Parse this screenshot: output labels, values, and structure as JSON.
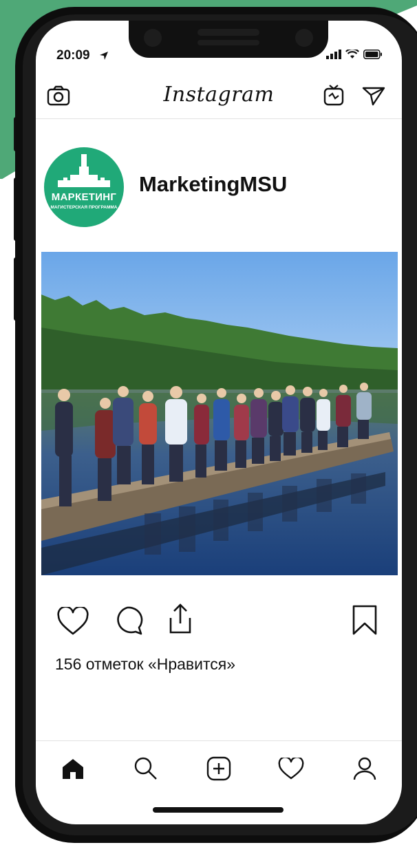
{
  "status": {
    "time": "20:09"
  },
  "header": {
    "title": "Instagram"
  },
  "profile": {
    "username": "MarketingMSU",
    "avatar_title": "МАРКЕТИНГ",
    "avatar_subtitle": "МАГИСТЕРСКАЯ ПРОГРАММА"
  },
  "post": {
    "likes_text": "156 отметок «Нравится»"
  },
  "icons": {
    "header": [
      "camera-icon",
      "igtv-icon",
      "send-icon"
    ],
    "actions": [
      "heart-icon",
      "comment-icon",
      "share-icon",
      "bookmark-icon"
    ],
    "tabbar": [
      "home-icon",
      "search-icon",
      "add-post-icon",
      "activity-icon",
      "profile-icon"
    ]
  },
  "colors": {
    "brand_green": "#20a978",
    "background_green": "#4fa877"
  }
}
